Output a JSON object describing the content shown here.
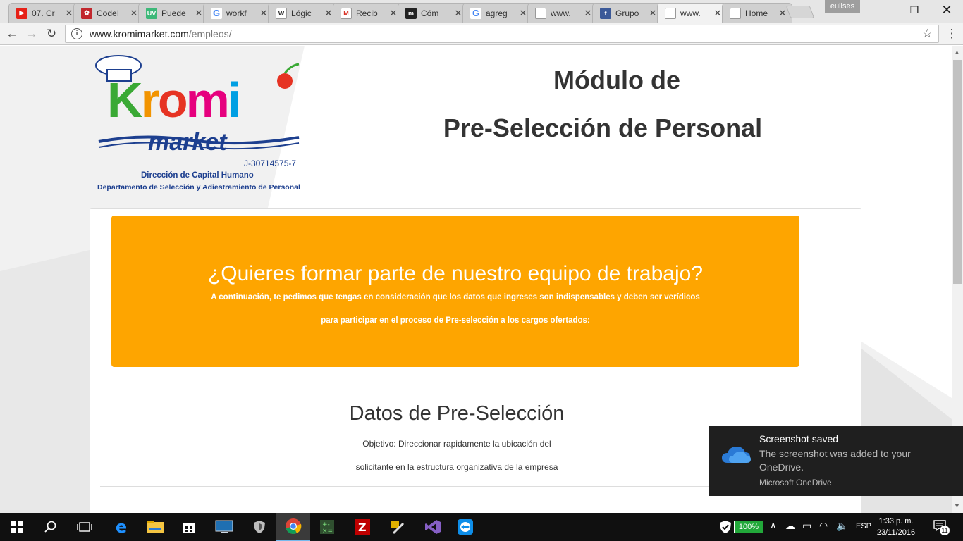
{
  "browser": {
    "tabs": [
      {
        "title": "07. Cr",
        "favicon": "youtube-icon",
        "color": "#e62117",
        "glyph": "▶"
      },
      {
        "title": "CodeI",
        "favicon": "codeigniter-icon",
        "color": "#c1272d",
        "glyph": "✿"
      },
      {
        "title": "Puede",
        "favicon": "uv-icon",
        "color": "#3cb878",
        "glyph": "UV"
      },
      {
        "title": "workf",
        "favicon": "google-icon",
        "color": "#4285f4",
        "glyph": "G"
      },
      {
        "title": "Lógic",
        "favicon": "wikipedia-icon",
        "color": "#ffffff",
        "glyph": "W"
      },
      {
        "title": "Recib",
        "favicon": "gmail-icon",
        "color": "#ffffff",
        "glyph": "M"
      },
      {
        "title": "Cóm",
        "favicon": "medium-icon",
        "color": "#222222",
        "glyph": "m"
      },
      {
        "title": "agreg",
        "favicon": "google-icon",
        "color": "#4285f4",
        "glyph": "G"
      },
      {
        "title": "www.",
        "favicon": "page-icon",
        "color": "#ffffff",
        "glyph": ""
      },
      {
        "title": "Grupo",
        "favicon": "facebook-icon",
        "color": "#3b5998",
        "glyph": "f"
      },
      {
        "title": "www.",
        "favicon": "page-icon",
        "color": "#ffffff",
        "glyph": ""
      },
      {
        "title": "Home",
        "favicon": "page-icon",
        "color": "#ffffff",
        "glyph": ""
      }
    ],
    "active_tab_index": 10,
    "profile_name": "eulises",
    "url_host": "www.kromimarket.com",
    "url_path": "/empleos/"
  },
  "page": {
    "logo": {
      "brand_top": "Kromi",
      "brand_bottom": "market",
      "rif": "J-30714575-7",
      "dept_line1": "Dirección de Capital Humano",
      "dept_line2": "Departamento de Selección y Adiestramiento de Personal",
      "brand_colors": [
        "#e63323",
        "#3aa935",
        "#f29400",
        "#e6007e",
        "#009fe3"
      ]
    },
    "title_line1": "Módulo de",
    "title_line2": "Pre-Selección de Personal",
    "banner": {
      "headline": "¿Quieres formar parte de nuestro equipo de trabajo?",
      "line1": "A continuación, te pedimos que tengas en consideración que los datos que ingreses son indispensables y deben ser verídicos",
      "line2": "para participar en el proceso de Pre-selección a los cargos ofertados:",
      "color": "#fea500"
    },
    "section_title": "Datos de Pre-Selección",
    "objective_line1": "Objetivo: Direccionar rapidamente la ubicación del",
    "objective_line2": "solicitante en la estructura organizativa de la empresa"
  },
  "toast": {
    "title": "Screenshot saved",
    "body_line1": "The screenshot was added to your",
    "body_line2": "OneDrive.",
    "app": "Microsoft OneDrive"
  },
  "taskbar": {
    "battery": "100%",
    "language": "ESP",
    "time": "1:33 p. m.",
    "date": "23/11/2016",
    "notifications_count": "11"
  }
}
